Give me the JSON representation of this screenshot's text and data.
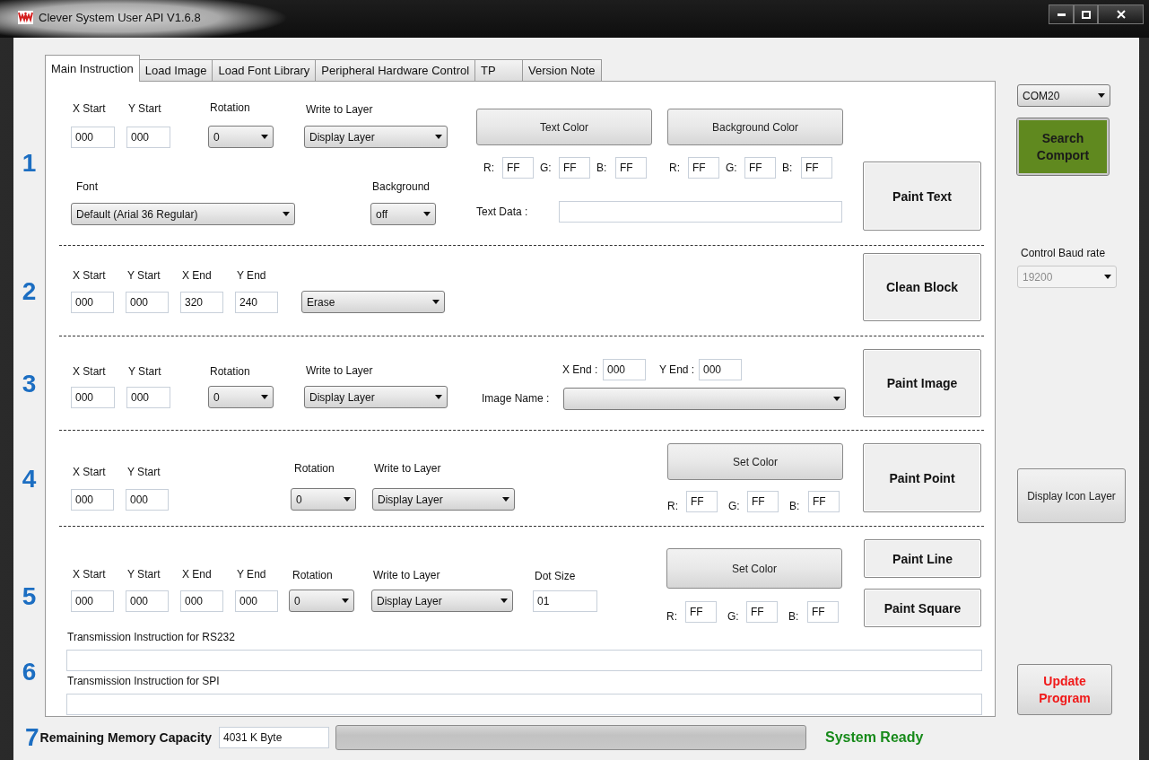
{
  "window": {
    "title": "Clever System User API V1.6.8"
  },
  "tabs": [
    {
      "label": "Main Instruction",
      "selected": true
    },
    {
      "label": "Load Image",
      "selected": false
    },
    {
      "label": "Load Font Library",
      "selected": false
    },
    {
      "label": "Peripheral Hardware Control",
      "selected": false
    },
    {
      "label": "TP",
      "selected": false
    },
    {
      "label": "Version Note",
      "selected": false
    }
  ],
  "sections": [
    {
      "kind": "text",
      "number": "1",
      "x_start": {
        "label": "X Start",
        "value": "000"
      },
      "y_start": {
        "label": "Y Start",
        "value": "000"
      },
      "rotation": {
        "label": "Rotation",
        "value": "0"
      },
      "layer": {
        "label": "Write to Layer",
        "value": "Display Layer"
      },
      "font": {
        "label": "Font",
        "value": "Default (Arial 36 Regular)"
      },
      "background": {
        "label": "Background",
        "value": "off"
      },
      "text_color": {
        "button": "Text Color",
        "r": {
          "label": "R:",
          "value": "FF"
        },
        "g": {
          "label": "G:",
          "value": "FF"
        },
        "b": {
          "label": "B:",
          "value": "FF"
        }
      },
      "background_color": {
        "button": "Background Color",
        "r": {
          "label": "R:",
          "value": "FF"
        },
        "g": {
          "label": "G:",
          "value": "FF"
        },
        "b": {
          "label": "B:",
          "value": "FF"
        }
      },
      "text_data": {
        "label": "Text Data :"
      },
      "action": "Paint Text"
    },
    {
      "kind": "clean",
      "number": "2",
      "x_start": {
        "label": "X Start",
        "value": "000"
      },
      "y_start": {
        "label": "Y Start",
        "value": "000"
      },
      "x_end": {
        "label": "X End",
        "value": "320"
      },
      "y_end": {
        "label": "Y End",
        "value": "240"
      },
      "mode": {
        "value": "Erase"
      },
      "action": "Clean Block"
    },
    {
      "kind": "image",
      "number": "3",
      "x_start": {
        "label": "X Start",
        "value": "000"
      },
      "y_start": {
        "label": "Y Start",
        "value": "000"
      },
      "rotation": {
        "label": "Rotation",
        "value": "0"
      },
      "layer": {
        "label": "Write to Layer",
        "value": "Display Layer"
      },
      "x_end": {
        "label": "X End :",
        "value": "000"
      },
      "y_end": {
        "label": "Y End :",
        "value": "000"
      },
      "image_name": {
        "label": "Image Name :"
      },
      "action": "Paint Image"
    },
    {
      "kind": "point",
      "number": "4",
      "x_start": {
        "label": "X Start",
        "value": "000"
      },
      "y_start": {
        "label": "Y Start",
        "value": "000"
      },
      "rotation": {
        "label": "Rotation",
        "value": "0"
      },
      "layer": {
        "label": "Write to Layer",
        "value": "Display Layer"
      },
      "color": {
        "button": "Set Color",
        "r": {
          "label": "R:",
          "value": "FF"
        },
        "g": {
          "label": "G:",
          "value": "FF"
        },
        "b": {
          "label": "B:",
          "value": "FF"
        }
      },
      "action": "Paint Point"
    },
    {
      "kind": "line",
      "number": "5",
      "x_start": {
        "label": "X Start",
        "value": "000"
      },
      "y_start": {
        "label": "Y Start",
        "value": "000"
      },
      "x_end": {
        "label": "X End",
        "value": "000"
      },
      "y_end": {
        "label": "Y End",
        "value": "000"
      },
      "rotation": {
        "label": "Rotation",
        "value": "0"
      },
      "layer": {
        "label": "Write to Layer",
        "value": "Display Layer"
      },
      "dot_size": {
        "label": "Dot Size",
        "value": "01"
      },
      "color": {
        "button": "Set Color",
        "r": {
          "label": "R:",
          "value": "FF"
        },
        "g": {
          "label": "G:",
          "value": "FF"
        },
        "b": {
          "label": "B:",
          "value": "FF"
        }
      },
      "actions": [
        "Paint Line",
        "Paint Square"
      ]
    },
    {
      "kind": "transmission",
      "number": "6",
      "fields": [
        {
          "label": "Transmission Instruction for RS232"
        },
        {
          "label": "Transmission Instruction for SPI"
        }
      ]
    }
  ],
  "status": {
    "number": "7",
    "memory_label": "Remaining Memory Capacity",
    "memory_value": "4031 K Byte",
    "message": "System Ready"
  },
  "sidebar": {
    "port": {
      "value": "COM20"
    },
    "search_button": "Search Comport",
    "baud": {
      "label": "Control Baud rate",
      "value": "19200",
      "disabled": true
    },
    "icon_layer_button": "Display Icon Layer",
    "update_button": "Update Program"
  }
}
